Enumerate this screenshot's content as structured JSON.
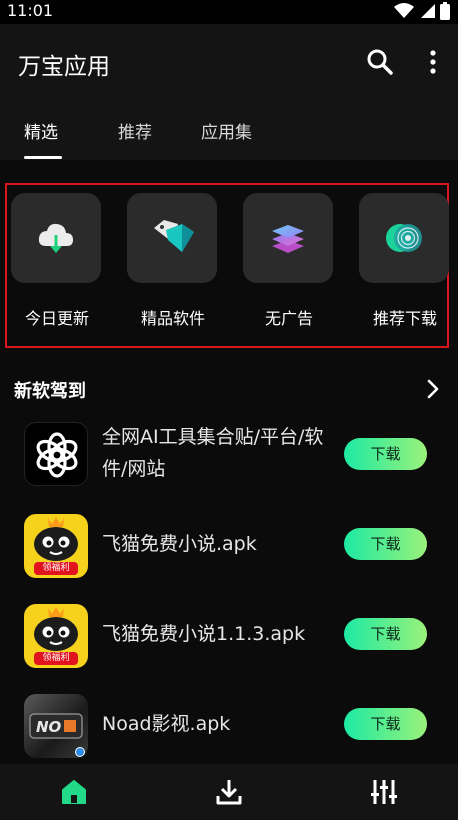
{
  "status_bar": {
    "time": "11:01",
    "icons": [
      "wifi-icon",
      "signal-icon",
      "battery-icon"
    ]
  },
  "app_bar": {
    "title": "万宝应用",
    "icons": [
      "search-icon",
      "more-vertical-icon"
    ]
  },
  "tabs": [
    {
      "label": "精选",
      "active": true
    },
    {
      "label": "推荐",
      "active": false
    },
    {
      "label": "应用集",
      "active": false
    }
  ],
  "categories": [
    {
      "label": "今日更新",
      "icon": "cloud-download-icon"
    },
    {
      "label": "精品软件",
      "icon": "diamond-icon"
    },
    {
      "label": "无广告",
      "icon": "layers-icon"
    },
    {
      "label": "推荐下载",
      "icon": "target-icon"
    }
  ],
  "section": {
    "title": "新软驾到",
    "arrow_icon": "chevron-right-icon"
  },
  "apps": [
    {
      "name": "全网AI工具集合贴/平台/软件/网站",
      "button": "下载",
      "icon": "openai-logo-icon"
    },
    {
      "name": "飞猫免费小说.apk",
      "button": "下载",
      "icon": "feimao-novel-icon",
      "icon_badge": "领福利"
    },
    {
      "name": "飞猫免费小说1.1.3.apk",
      "button": "下载",
      "icon": "feimao-novel-icon",
      "icon_badge": "领福利"
    },
    {
      "name": "Noad影视.apk",
      "button": "下载",
      "icon": "noad-video-icon"
    }
  ],
  "bottom_nav": [
    {
      "icon": "home-icon",
      "active": true
    },
    {
      "icon": "download-icon",
      "active": false
    },
    {
      "icon": "equalizer-icon",
      "active": false
    }
  ],
  "colors": {
    "accent_green": "#22d98a",
    "highlight_border": "#d9161c",
    "background": "#000000"
  }
}
